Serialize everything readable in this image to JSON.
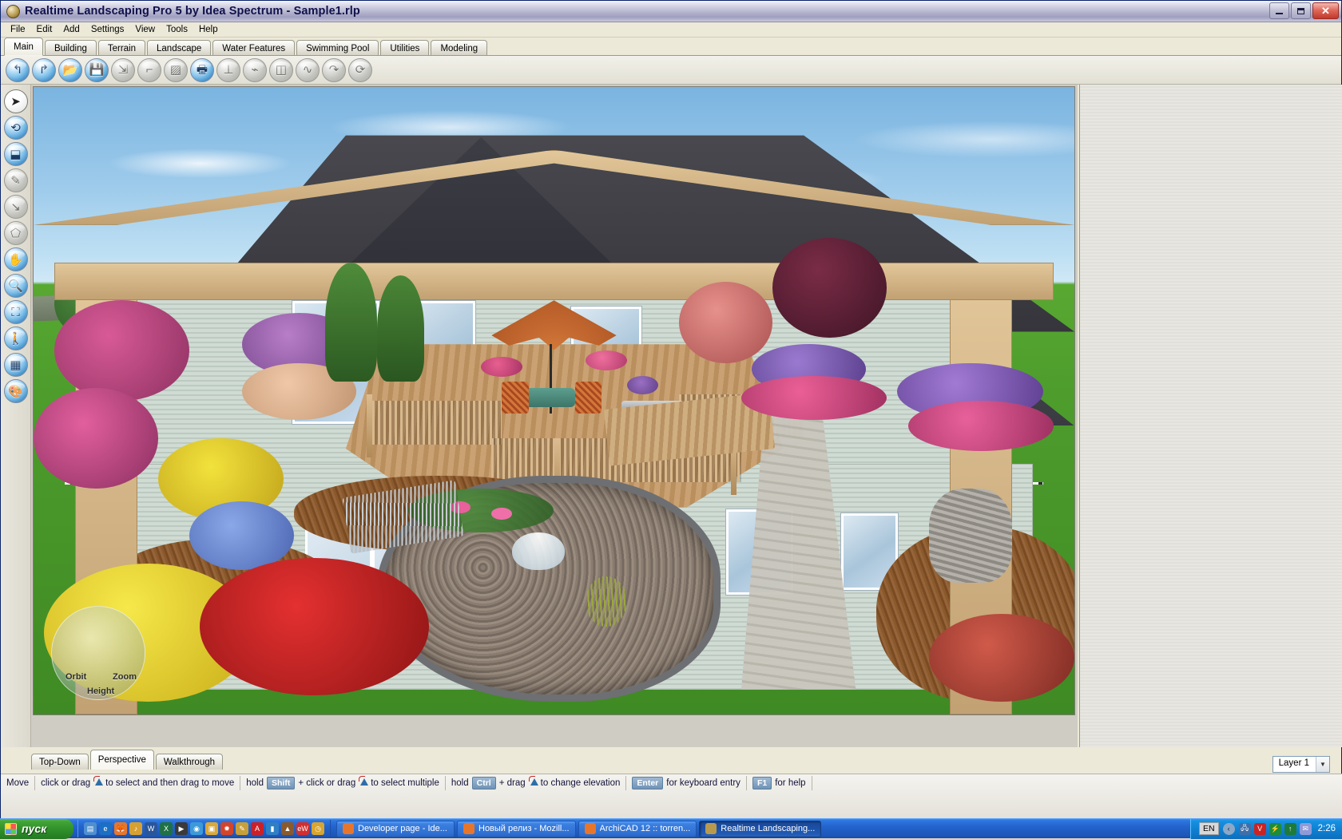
{
  "window": {
    "title": "Realtime Landscaping Pro 5 by Idea Spectrum - Sample1.rlp",
    "app_icon": "app-globe-icon",
    "minimize_label": "–",
    "restore_label": "❐",
    "close_label": "✕"
  },
  "menu": {
    "items": [
      {
        "label": "File"
      },
      {
        "label": "Edit"
      },
      {
        "label": "Add"
      },
      {
        "label": "Settings"
      },
      {
        "label": "View"
      },
      {
        "label": "Tools"
      },
      {
        "label": "Help"
      }
    ]
  },
  "tabs": {
    "active": "Main",
    "items": [
      {
        "label": "Main"
      },
      {
        "label": "Building"
      },
      {
        "label": "Terrain"
      },
      {
        "label": "Landscape"
      },
      {
        "label": "Water Features"
      },
      {
        "label": "Swimming Pool"
      },
      {
        "label": "Utilities"
      },
      {
        "label": "Modeling"
      }
    ]
  },
  "toolbar": {
    "buttons": [
      {
        "name": "undo",
        "glyph": "↰",
        "state": "on"
      },
      {
        "name": "redo",
        "glyph": "↱",
        "state": "on"
      },
      {
        "name": "open-project",
        "glyph": "📂",
        "state": "on"
      },
      {
        "name": "save-project",
        "glyph": "💾",
        "state": "on"
      },
      {
        "name": "measure-tool",
        "glyph": "⇲",
        "state": "off"
      },
      {
        "name": "dimension-tool",
        "glyph": "⌐",
        "state": "off"
      },
      {
        "name": "eraser-tool",
        "glyph": "▨",
        "state": "off"
      },
      {
        "name": "print",
        "glyph": "🖶",
        "state": "on"
      },
      {
        "name": "ground-plane",
        "glyph": "⊥",
        "state": "off"
      },
      {
        "name": "flatten-terrain",
        "glyph": "⌁",
        "state": "off"
      },
      {
        "name": "mirror",
        "glyph": "◫",
        "state": "off"
      },
      {
        "name": "smooth",
        "glyph": "∿",
        "state": "off"
      },
      {
        "name": "curve",
        "glyph": "↷",
        "state": "off"
      },
      {
        "name": "rotate-object",
        "glyph": "⟳",
        "state": "off"
      }
    ]
  },
  "left_toolbar": {
    "buttons": [
      {
        "name": "select-arrow",
        "glyph": "➤",
        "state": "sel"
      },
      {
        "name": "rotate-view",
        "glyph": "⟲",
        "state": "on"
      },
      {
        "name": "scale-object",
        "glyph": "⬓",
        "state": "on"
      },
      {
        "name": "freehand-draw",
        "glyph": "✎",
        "state": "off"
      },
      {
        "name": "line-draw",
        "glyph": "↘",
        "state": "off"
      },
      {
        "name": "polygon-draw",
        "glyph": "⬠",
        "state": "off"
      },
      {
        "name": "pan-hand",
        "glyph": "✋",
        "state": "on"
      },
      {
        "name": "zoom-magnifier",
        "glyph": "🔍",
        "state": "on"
      },
      {
        "name": "zoom-region",
        "glyph": "⛶",
        "state": "on"
      },
      {
        "name": "walk-navigate",
        "glyph": "🚶",
        "state": "on"
      },
      {
        "name": "terrain-grid",
        "glyph": "▦",
        "state": "on"
      },
      {
        "name": "material-paint",
        "glyph": "🎨",
        "state": "on"
      }
    ]
  },
  "nav_widget": {
    "orbit_label": "Orbit",
    "zoom_label": "Zoom",
    "height_label": "Height"
  },
  "view_tabs": {
    "active": "Perspective",
    "items": [
      {
        "label": "Top-Down"
      },
      {
        "label": "Perspective"
      },
      {
        "label": "Walkthrough"
      }
    ]
  },
  "layer_combo": {
    "value": "Layer 1",
    "arrow": "▼"
  },
  "statusbar": {
    "mode_label": "Move",
    "segments": [
      {
        "pre": "click or drag",
        "cursor": true,
        "post": "to select and then drag to move"
      },
      {
        "pre": "hold",
        "key": "Shift",
        "mid": "+ click or drag",
        "cursor": true,
        "post": "to select multiple"
      },
      {
        "pre": "hold",
        "key": "Ctrl",
        "mid": "+ drag",
        "cursor": true,
        "post": "to change elevation"
      },
      {
        "key": "Enter",
        "post": "for keyboard entry"
      },
      {
        "key": "F1",
        "post": "for help"
      }
    ]
  },
  "taskbar": {
    "start_label": "пуск",
    "quick_launch": [
      {
        "name": "show-desktop-icon",
        "glyph": "▤",
        "color": "#4f8fd0"
      },
      {
        "name": "internet-explorer-icon",
        "glyph": "e",
        "color": "#1b6fc4"
      },
      {
        "name": "firefox-icon",
        "glyph": "🦊",
        "color": "#e8762a"
      },
      {
        "name": "media-player-icon",
        "glyph": "♪",
        "color": "#d8a030"
      },
      {
        "name": "word-icon",
        "glyph": "W",
        "color": "#2a5699"
      },
      {
        "name": "excel-icon",
        "glyph": "X",
        "color": "#1e7145"
      },
      {
        "name": "play-icon",
        "glyph": "▶",
        "color": "#3a3a3a"
      },
      {
        "name": "winamp-icon",
        "glyph": "◉",
        "color": "#3d9ad8"
      },
      {
        "name": "folder-icon",
        "glyph": "▣",
        "color": "#d9a93c"
      },
      {
        "name": "star-icon",
        "glyph": "✹",
        "color": "#d4442a"
      },
      {
        "name": "pencil-icon",
        "glyph": "✎",
        "color": "#c7a03a"
      },
      {
        "name": "acrobat-icon",
        "glyph": "A",
        "color": "#cc2027"
      },
      {
        "name": "battery-icon",
        "glyph": "▮",
        "color": "#2f7fc4"
      },
      {
        "name": "picture-icon",
        "glyph": "▲",
        "color": "#8a5a2c"
      },
      {
        "name": "ebay-icon",
        "glyph": "eW",
        "color": "#d42e2e"
      },
      {
        "name": "clock-icon",
        "glyph": "◷",
        "color": "#d8a530"
      }
    ],
    "windows": [
      {
        "label": "Developer page - Ide...",
        "icon": "firefox-icon",
        "color": "#e8762a",
        "active": false
      },
      {
        "label": "Новый релиз - Mozill...",
        "icon": "firefox-icon",
        "color": "#e8762a",
        "active": false
      },
      {
        "label": "ArchiCAD 12 :: torren...",
        "icon": "firefox-icon",
        "color": "#e8762a",
        "active": false
      },
      {
        "label": "Realtime Landscaping...",
        "icon": "app-globe-icon",
        "color": "#b79a4e",
        "active": true
      }
    ],
    "tray": {
      "language": "EN",
      "show_hidden": "‹",
      "icons": [
        {
          "name": "network-icon",
          "glyph": "🖧",
          "color": "#3f6fa8"
        },
        {
          "name": "antivirus-icon",
          "glyph": "V",
          "color": "#c22"
        },
        {
          "name": "power-icon",
          "glyph": "⚡",
          "color": "#1d8c3a"
        },
        {
          "name": "updates-icon",
          "glyph": "↑",
          "color": "#1d7a3a"
        },
        {
          "name": "mail-icon",
          "glyph": "✉",
          "color": "#8f9ad8"
        }
      ],
      "clock": "2:26"
    }
  },
  "scene": {
    "description": "3D landscape design perspective view: two-story pale-green sided house with dark shingled roof, wooden deck with patio umbrella table set, pond with lily pads and bubbler fountain, flower beds, benches, garden arbor and stone pathways.",
    "sky_color": "#9ecbeb",
    "grass_color": "#4d9c2c",
    "house_wall_color": "#cfdbd3",
    "roof_color": "#3d3d45",
    "deck_color": "#c9a173",
    "mulch_color": "#8a5a2c",
    "umbrella_color": "#c2672f"
  }
}
